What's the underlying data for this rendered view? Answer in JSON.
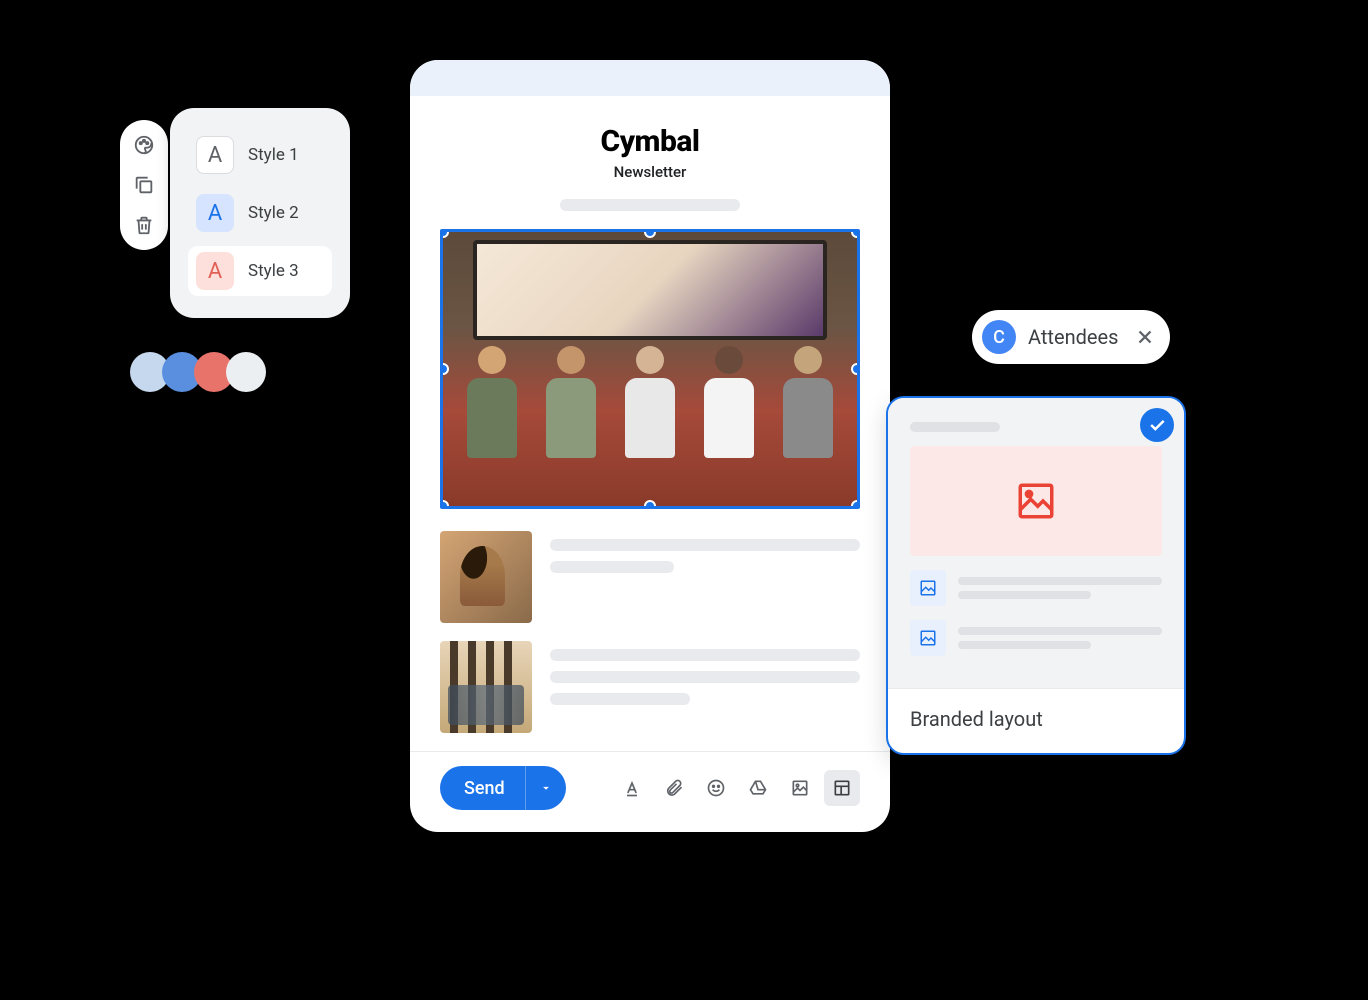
{
  "style_picker": {
    "styles": [
      {
        "label": "Style 1",
        "letter": "A"
      },
      {
        "label": "Style 2",
        "letter": "A"
      },
      {
        "label": "Style 3",
        "letter": "A"
      }
    ]
  },
  "color_palette": [
    "#c6d8ee",
    "#5a8fe0",
    "#e8736b",
    "#eceff1"
  ],
  "composer": {
    "brand": "Cymbal",
    "subhead": "Newsletter",
    "send_label": "Send"
  },
  "chip": {
    "avatar_letter": "C",
    "label": "Attendees"
  },
  "layout_card": {
    "title": "Branded layout"
  }
}
